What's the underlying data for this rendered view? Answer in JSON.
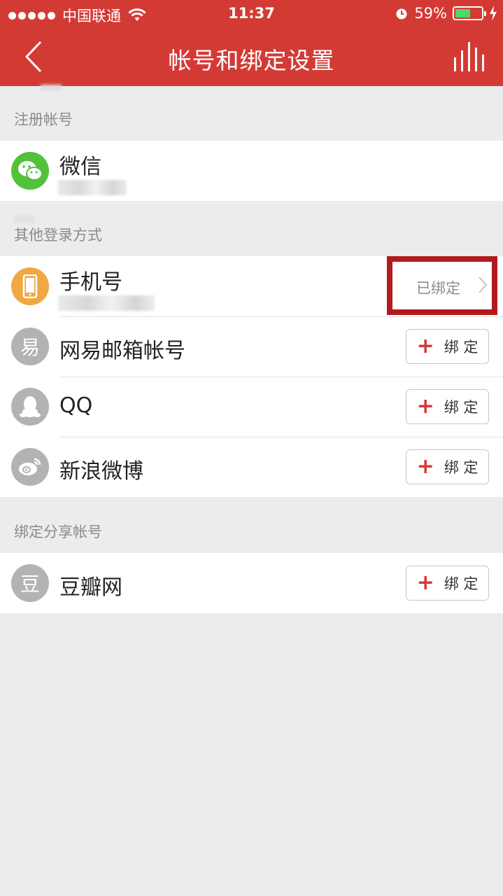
{
  "status_bar": {
    "carrier": "中国联通",
    "time": "11:37",
    "battery": "59%",
    "battery_level": 0.59
  },
  "navbar": {
    "title": "帐号和绑定设置",
    "back_icon": "chevron-left-icon",
    "stats_icon": "bar-chart-icon"
  },
  "sections": {
    "registered": "注册帐号",
    "other_login": "其他登录方式",
    "share": "绑定分享帐号"
  },
  "registered_account": {
    "title": "微信",
    "icon": "wechat-icon",
    "icon_color": "#52c23a"
  },
  "login_methods": [
    {
      "title": "手机号",
      "icon": "phone-icon",
      "icon_color": "#f0a844",
      "status": "已绑定"
    },
    {
      "title": "网易邮箱帐号",
      "icon": "netease-icon",
      "icon_glyph": "易",
      "icon_color": "#b3b3b3"
    },
    {
      "title": "QQ",
      "icon": "qq-icon",
      "icon_color": "#b3b3b3"
    },
    {
      "title": "新浪微博",
      "icon": "weibo-icon",
      "icon_color": "#b3b3b3"
    }
  ],
  "share_accounts": [
    {
      "title": "豆瓣网",
      "icon": "douban-icon",
      "icon_glyph": "豆",
      "icon_color": "#b3b3b3"
    }
  ],
  "bind_button": {
    "plus": "+",
    "label": "绑 定"
  },
  "colors": {
    "brand_red": "#d43a34",
    "highlight_red": "#b21a1d",
    "background": "#ebecee"
  }
}
